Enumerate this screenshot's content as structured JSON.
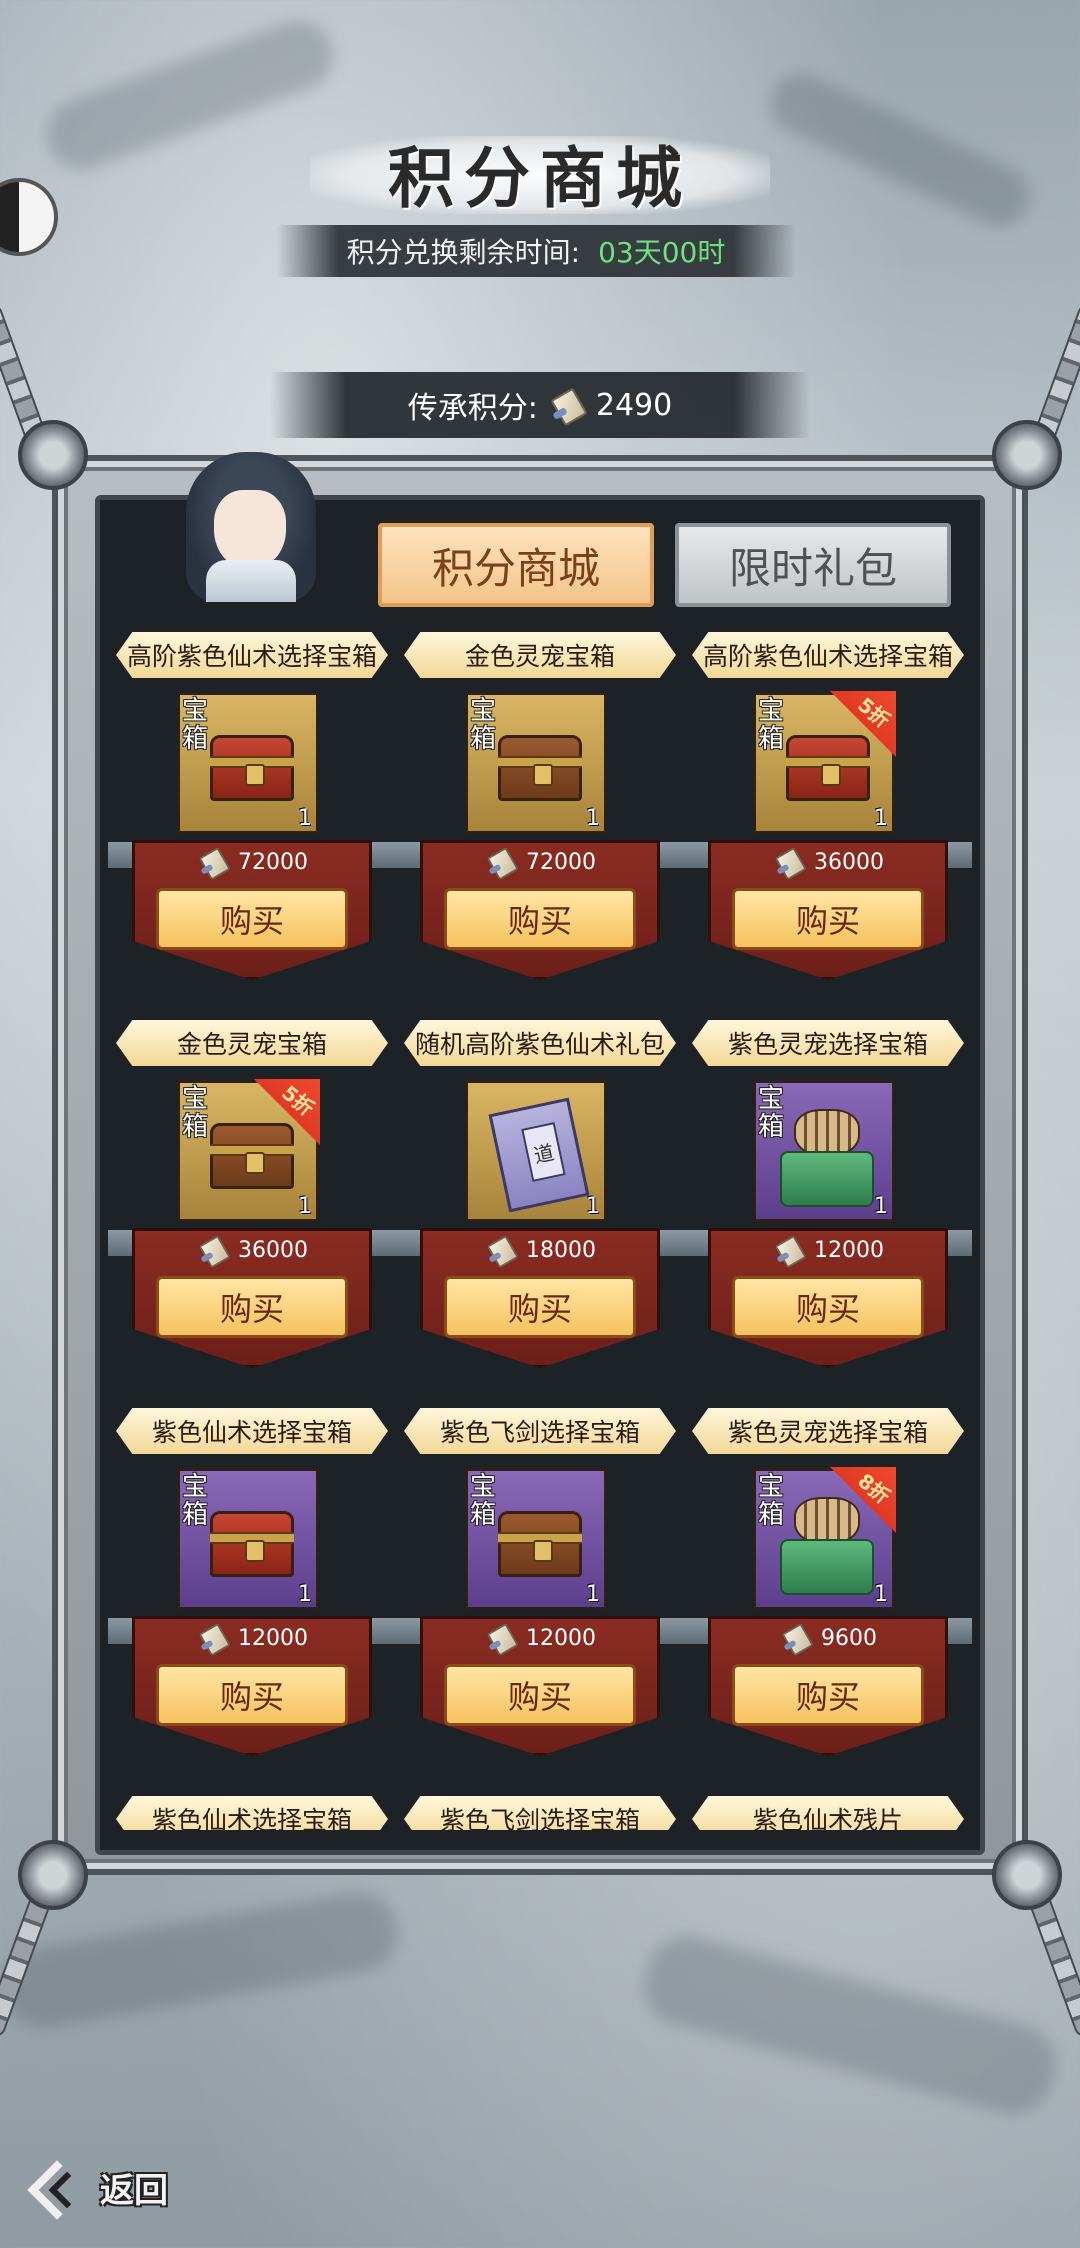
{
  "header": {
    "title": "积分商城",
    "timer_label": "积分兑换剩余时间:",
    "timer_value": "03天00时",
    "points_label": "传承积分:",
    "points_value": "2490"
  },
  "tabs": [
    {
      "label": "积分商城",
      "active": true
    },
    {
      "label": "限时礼包",
      "active": false
    }
  ],
  "items": [
    {
      "name": "高阶紫色仙术选择宝箱",
      "box_label": "宝箱",
      "count": "1",
      "price": "72000",
      "buy_label": "购买",
      "discount": "",
      "frame": "gold",
      "art": "red-chest"
    },
    {
      "name": "金色灵宠宝箱",
      "box_label": "宝箱",
      "count": "1",
      "price": "72000",
      "buy_label": "购买",
      "discount": "",
      "frame": "gold",
      "art": "chest"
    },
    {
      "name": "高阶紫色仙术选择宝箱",
      "box_label": "宝箱",
      "count": "1",
      "price": "36000",
      "buy_label": "购买",
      "discount": "5折",
      "frame": "gold",
      "art": "red-chest"
    },
    {
      "name": "金色灵宠宝箱",
      "box_label": "宝箱",
      "count": "1",
      "price": "36000",
      "buy_label": "购买",
      "discount": "5折",
      "frame": "gold",
      "art": "chest"
    },
    {
      "name": "随机高阶紫色仙术礼包",
      "box_label": "",
      "count": "1",
      "price": "18000",
      "buy_label": "购买",
      "discount": "",
      "frame": "gold",
      "art": "book"
    },
    {
      "name": "紫色灵宠选择宝箱",
      "box_label": "宝箱",
      "count": "1",
      "price": "12000",
      "buy_label": "购买",
      "discount": "",
      "frame": "purple",
      "art": "tiger"
    },
    {
      "name": "紫色仙术选择宝箱",
      "box_label": "宝箱",
      "count": "1",
      "price": "12000",
      "buy_label": "购买",
      "discount": "",
      "frame": "purple",
      "art": "red-chest"
    },
    {
      "name": "紫色飞剑选择宝箱",
      "box_label": "宝箱",
      "count": "1",
      "price": "12000",
      "buy_label": "购买",
      "discount": "",
      "frame": "purple",
      "art": "chest"
    },
    {
      "name": "紫色灵宠选择宝箱",
      "box_label": "宝箱",
      "count": "1",
      "price": "9600",
      "buy_label": "购买",
      "discount": "8折",
      "frame": "purple",
      "art": "tiger"
    },
    {
      "name": "紫色仙术选择宝箱"
    },
    {
      "name": "紫色飞剑选择宝箱"
    },
    {
      "name": "紫色仙术残片"
    }
  ],
  "footer": {
    "back_label": "返回"
  }
}
